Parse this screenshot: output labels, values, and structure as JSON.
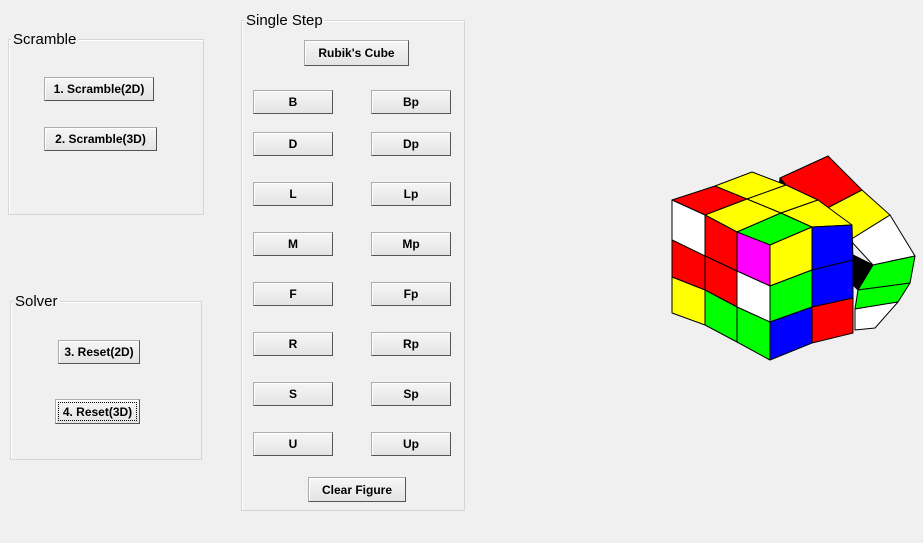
{
  "scramble": {
    "title": "Scramble",
    "btn1": "1. Scramble(2D)",
    "btn2": "2. Scramble(3D)"
  },
  "solver": {
    "title": "Solver",
    "btn3": "3. Reset(2D)",
    "btn4": "4. Reset(3D)"
  },
  "single_step": {
    "title": "Single Step",
    "rubiks": "Rubik's Cube",
    "moves": {
      "B": "B",
      "Bp": "Bp",
      "D": "D",
      "Dp": "Dp",
      "L": "L",
      "Lp": "Lp",
      "M": "M",
      "Mp": "Mp",
      "F": "F",
      "Fp": "Fp",
      "R": "R",
      "Rp": "Rp",
      "S": "S",
      "Sp": "Sp",
      "U": "U",
      "Up": "Up"
    },
    "clear": "Clear Figure"
  },
  "cube": {
    "description_colors": [
      "red",
      "yellow",
      "white",
      "green",
      "blue",
      "magenta",
      "black"
    ]
  }
}
